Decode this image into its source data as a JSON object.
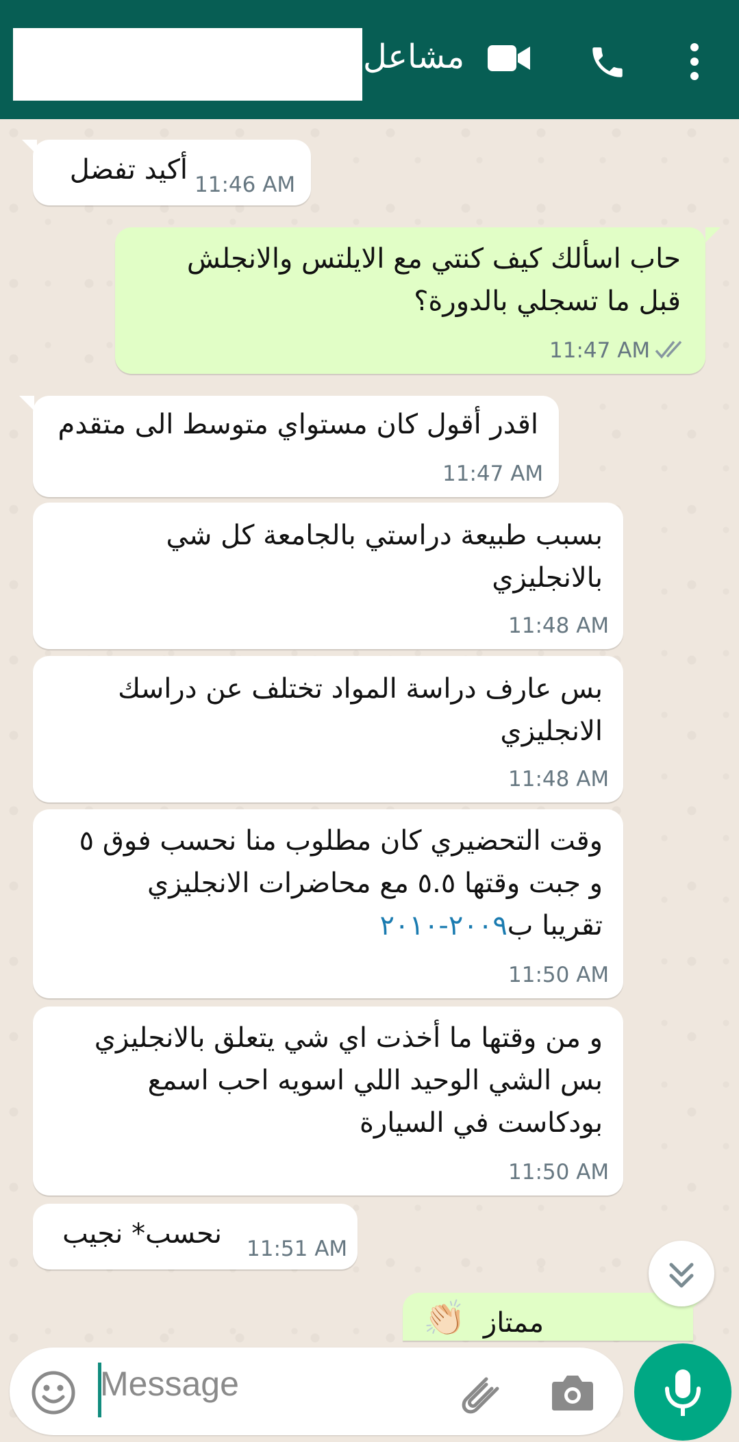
{
  "header": {
    "contact_name": "مشاعل",
    "icons": [
      "video-call-icon",
      "voice-call-icon",
      "more-options-icon"
    ]
  },
  "messages": [
    {
      "direction": "in",
      "text": [
        "أكيد تفضل"
      ],
      "time": "11:46 AM"
    },
    {
      "direction": "out",
      "text": [
        "حاب اسألك كيف كنتي مع الايلتس والانجلش",
        "قبل ما تسجلي بالدورة؟"
      ],
      "time": "11:47 AM",
      "status": "read"
    },
    {
      "direction": "in",
      "text": [
        "اقدر أقول كان مستواي متوسط الى متقدم"
      ],
      "time": "11:47 AM"
    },
    {
      "direction": "in",
      "text": [
        "بسبب طبيعة دراستي بالجامعة كل شي",
        "بالانجليزي"
      ],
      "time": "11:48 AM"
    },
    {
      "direction": "in",
      "text": [
        "بس عارف دراسة المواد تختلف عن دراسك",
        "الانجليزي"
      ],
      "time": "11:48 AM"
    },
    {
      "direction": "in",
      "text": [
        "وقت التحضيري كان مطلوب منا نحسب فوق ٥",
        "و جبت وقتها ٥.٥ مع محاضرات الانجليزي",
        "تقريبا ب"
      ],
      "link": "٢٠٠٩-٢٠١٠",
      "time": "11:50 AM"
    },
    {
      "direction": "in",
      "text": [
        "و من وقتها ما أخذت اي شي يتعلق بالانجليزي",
        "بس الشي الوحيد اللي اسويه احب اسمع",
        "بودكاست في السيارة"
      ],
      "time": "11:50 AM"
    },
    {
      "direction": "in",
      "text": [
        "نحسب* نجيب"
      ],
      "time": "11:51 AM"
    },
    {
      "direction": "out",
      "text": [
        "ممتاز"
      ],
      "emoji": "👏🏻"
    }
  ],
  "composer": {
    "placeholder": "Message",
    "icons": [
      "emoji-icon",
      "attach-icon",
      "camera-icon",
      "mic-icon"
    ]
  },
  "colors": {
    "header": "#075e54",
    "outgoing_bubble": "#e1fec6",
    "incoming_bubble": "#ffffff",
    "mic_button": "#00a884",
    "read_ticks": "#8696a0"
  }
}
